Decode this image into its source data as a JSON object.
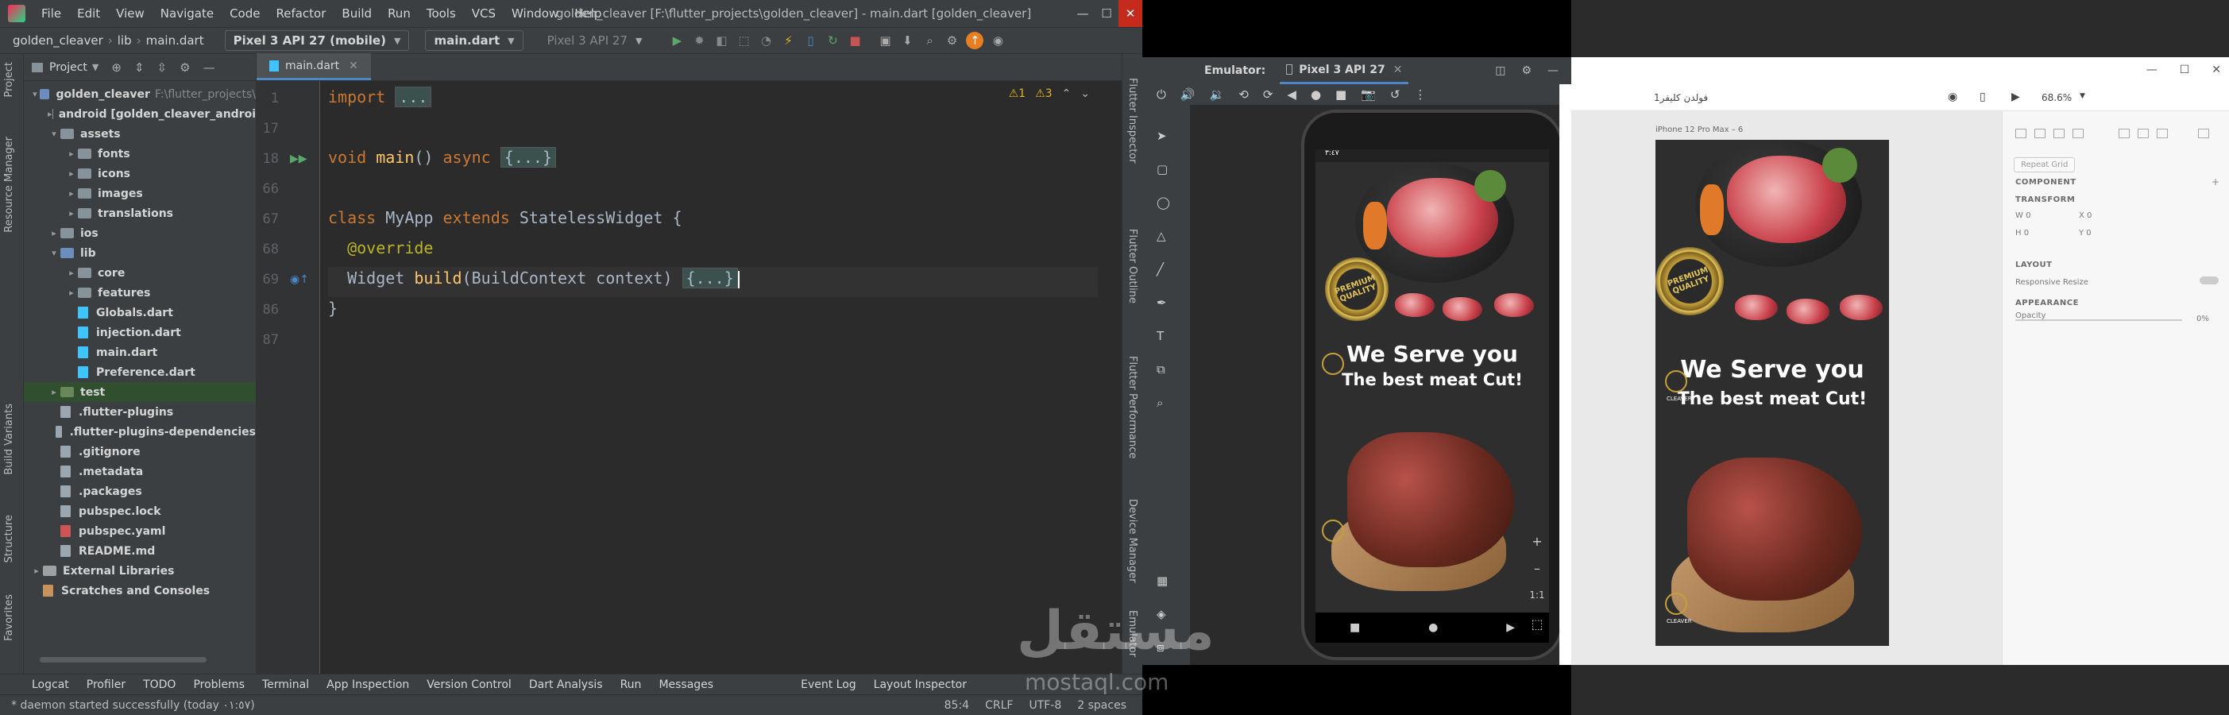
{
  "ide": {
    "window_title": "golden_cleaver [F:\\flutter_projects\\golden_cleaver] - main.dart [golden_cleaver]",
    "menu": [
      "File",
      "Edit",
      "View",
      "Navigate",
      "Code",
      "Refactor",
      "Build",
      "Run",
      "Tools",
      "VCS",
      "Window",
      "Help"
    ],
    "breadcrumb": [
      "golden_cleaver",
      "lib",
      "main.dart"
    ],
    "device_selector": "Pixel 3 API 27 (mobile)",
    "run_config": "main.dart",
    "device_selector_2": "Pixel 3 API 27",
    "left_tabs": [
      "Project",
      "Resource Manager",
      "Build Variants",
      "Structure",
      "Favorites"
    ],
    "right_tabs": [
      "Flutter Inspector",
      "Flutter Outline",
      "Flutter Performance",
      "Device Manager",
      "Emulator"
    ],
    "project_panel": {
      "title": "Project",
      "tree": [
        {
          "label": "golden_cleaver",
          "sub": "F:\\flutter_projects\\",
          "depth": 0,
          "arrow": "▾",
          "kind": "folder-blue"
        },
        {
          "label": "android [golden_cleaver_androi",
          "sub": "",
          "depth": 1,
          "arrow": "▸",
          "kind": "folder"
        },
        {
          "label": "assets",
          "sub": "",
          "depth": 1,
          "arrow": "▾",
          "kind": "folder"
        },
        {
          "label": "fonts",
          "sub": "",
          "depth": 2,
          "arrow": "▸",
          "kind": "folder"
        },
        {
          "label": "icons",
          "sub": "",
          "depth": 2,
          "arrow": "▸",
          "kind": "folder"
        },
        {
          "label": "images",
          "sub": "",
          "depth": 2,
          "arrow": "▸",
          "kind": "folder"
        },
        {
          "label": "translations",
          "sub": "",
          "depth": 2,
          "arrow": "▸",
          "kind": "folder"
        },
        {
          "label": "ios",
          "sub": "",
          "depth": 1,
          "arrow": "▸",
          "kind": "folder"
        },
        {
          "label": "lib",
          "sub": "",
          "depth": 1,
          "arrow": "▾",
          "kind": "folder-blue"
        },
        {
          "label": "core",
          "sub": "",
          "depth": 2,
          "arrow": "▸",
          "kind": "folder"
        },
        {
          "label": "features",
          "sub": "",
          "depth": 2,
          "arrow": "▸",
          "kind": "folder"
        },
        {
          "label": "Globals.dart",
          "sub": "",
          "depth": 2,
          "arrow": "",
          "kind": "dart"
        },
        {
          "label": "injection.dart",
          "sub": "",
          "depth": 2,
          "arrow": "",
          "kind": "dart"
        },
        {
          "label": "main.dart",
          "sub": "",
          "depth": 2,
          "arrow": "",
          "kind": "dart"
        },
        {
          "label": "Preference.dart",
          "sub": "",
          "depth": 2,
          "arrow": "",
          "kind": "dart"
        },
        {
          "label": "test",
          "sub": "",
          "depth": 1,
          "arrow": "▸",
          "kind": "folder-green"
        },
        {
          "label": ".flutter-plugins",
          "sub": "",
          "depth": 1,
          "arrow": "",
          "kind": "file"
        },
        {
          "label": ".flutter-plugins-dependencies",
          "sub": "",
          "depth": 1,
          "arrow": "",
          "kind": "file"
        },
        {
          "label": ".gitignore",
          "sub": "",
          "depth": 1,
          "arrow": "",
          "kind": "file"
        },
        {
          "label": ".metadata",
          "sub": "",
          "depth": 1,
          "arrow": "",
          "kind": "file"
        },
        {
          "label": ".packages",
          "sub": "",
          "depth": 1,
          "arrow": "",
          "kind": "file"
        },
        {
          "label": "pubspec.lock",
          "sub": "",
          "depth": 1,
          "arrow": "",
          "kind": "file"
        },
        {
          "label": "pubspec.yaml",
          "sub": "",
          "depth": 1,
          "arrow": "",
          "kind": "yaml"
        },
        {
          "label": "README.md",
          "sub": "",
          "depth": 1,
          "arrow": "",
          "kind": "file"
        },
        {
          "label": "External Libraries",
          "sub": "",
          "depth": 0,
          "arrow": "▸",
          "kind": "lib"
        },
        {
          "label": "Scratches and Consoles",
          "sub": "",
          "depth": 0,
          "arrow": "",
          "kind": "scratch"
        }
      ]
    },
    "editor": {
      "tab": "main.dart",
      "warnings": "⚠1",
      "weak_warnings": "⚠3",
      "lines": [
        {
          "num": "1",
          "text": "import ..."
        },
        {
          "num": "17",
          "text": ""
        },
        {
          "num": "18",
          "text": "void main() async {...}"
        },
        {
          "num": "66",
          "text": ""
        },
        {
          "num": "67",
          "text": "class MyApp extends StatelessWidget {"
        },
        {
          "num": "68",
          "text": "  @override"
        },
        {
          "num": "69",
          "text": "  Widget build(BuildContext context) {...}"
        },
        {
          "num": "86",
          "text": "}"
        },
        {
          "num": "87",
          "text": ""
        }
      ]
    },
    "bottom_tabs": [
      "Logcat",
      "Profiler",
      "TODO",
      "Problems",
      "Terminal",
      "App Inspection",
      "Version Control",
      "Dart Analysis",
      "Run",
      "Messages",
      "Event Log",
      "Layout Inspector"
    ],
    "status": {
      "message": "* daemon started successfully (today ٠١:٥٧)",
      "position": "85:4",
      "line_sep": "CRLF",
      "encoding": "UTF-8",
      "indent": "2 spaces"
    }
  },
  "emulator": {
    "label": "Emulator:",
    "device_tab": "Pixel 3 API 27",
    "zoom_plus": "+",
    "zoom_minus": "–",
    "zoom_ratio": "1:1",
    "status_time": "٣:٤٧"
  },
  "banner": {
    "headline": "We Serve you",
    "subline": "The best meat Cut!",
    "badge_top": "PREMIUM",
    "badge_bottom": "QUALITY",
    "brand": "CLEAVER"
  },
  "xd": {
    "file_title": "فولدن كليفر1",
    "zoom": "68.6%",
    "artboard_label": "iPhone 12 Pro Max – 6",
    "repeat_grid": "Repeat Grid",
    "sections": {
      "component": "COMPONENT",
      "transform": "TRANSFORM",
      "layout": "LAYOUT",
      "appearance": "APPEARANCE"
    },
    "transform": {
      "w": "W  0",
      "x": "X  0",
      "h": "H  0",
      "y": "Y  0"
    },
    "responsive_resize": "Responsive Resize",
    "opacity_label": "Opacity",
    "opacity_value": "0%"
  },
  "watermark": {
    "arabic": "مستقل",
    "latin": "mostaql.com"
  }
}
